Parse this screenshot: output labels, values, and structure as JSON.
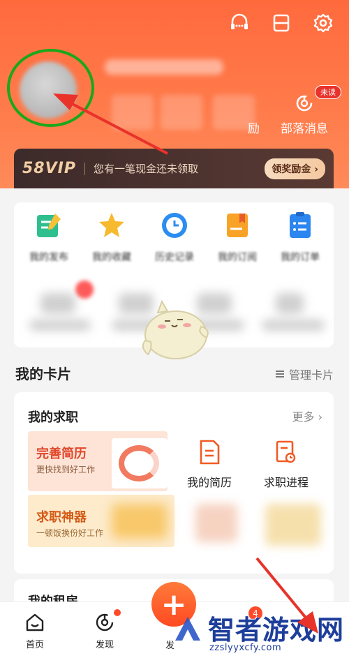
{
  "profile": {
    "unread_badge": "未读",
    "stat_label_partial": "励",
    "stat_label_tribe": "部落消息"
  },
  "vip": {
    "logo": "58VIP",
    "message": "您有一笔现金还未领取",
    "button": "领奖励金 ›"
  },
  "quick_actions": [
    {
      "label": "我的发布",
      "icon": "edit-note-icon"
    },
    {
      "label": "我的收藏",
      "icon": "star-icon"
    },
    {
      "label": "历史记录",
      "icon": "clock-icon"
    },
    {
      "label": "我的订阅",
      "icon": "bookmark-doc-icon"
    },
    {
      "label": "我的订单",
      "icon": "order-list-icon"
    }
  ],
  "cards_section": {
    "title": "我的卡片",
    "manage": "管理卡片"
  },
  "job_card": {
    "title": "我的求职",
    "more": "更多 ›",
    "tiles": [
      {
        "title": "完善简历",
        "subtitle": "更快找到好工作"
      },
      {
        "title": "求职神器",
        "subtitle": "一顿饭换份好工作"
      }
    ],
    "icons": [
      {
        "label": "我的简历",
        "icon": "resume-icon"
      },
      {
        "label": "求职进程",
        "icon": "job-progress-icon"
      }
    ]
  },
  "rent_card": {
    "title": "我的租房"
  },
  "tabbar": {
    "items": [
      {
        "label": "首页",
        "icon": "home-icon"
      },
      {
        "label": "发现",
        "icon": "discover-icon"
      },
      {
        "label": "发",
        "icon": "plus-icon"
      }
    ],
    "badge_count": "4"
  },
  "watermark": {
    "text": "智者游戏网",
    "url": "zzslyyxcfy.com"
  },
  "colors": {
    "header": "#ff6a3d",
    "annotation_circle": "#1aa81a",
    "annotation_arrow": "#e8322a",
    "accent": "#ff4a22"
  }
}
